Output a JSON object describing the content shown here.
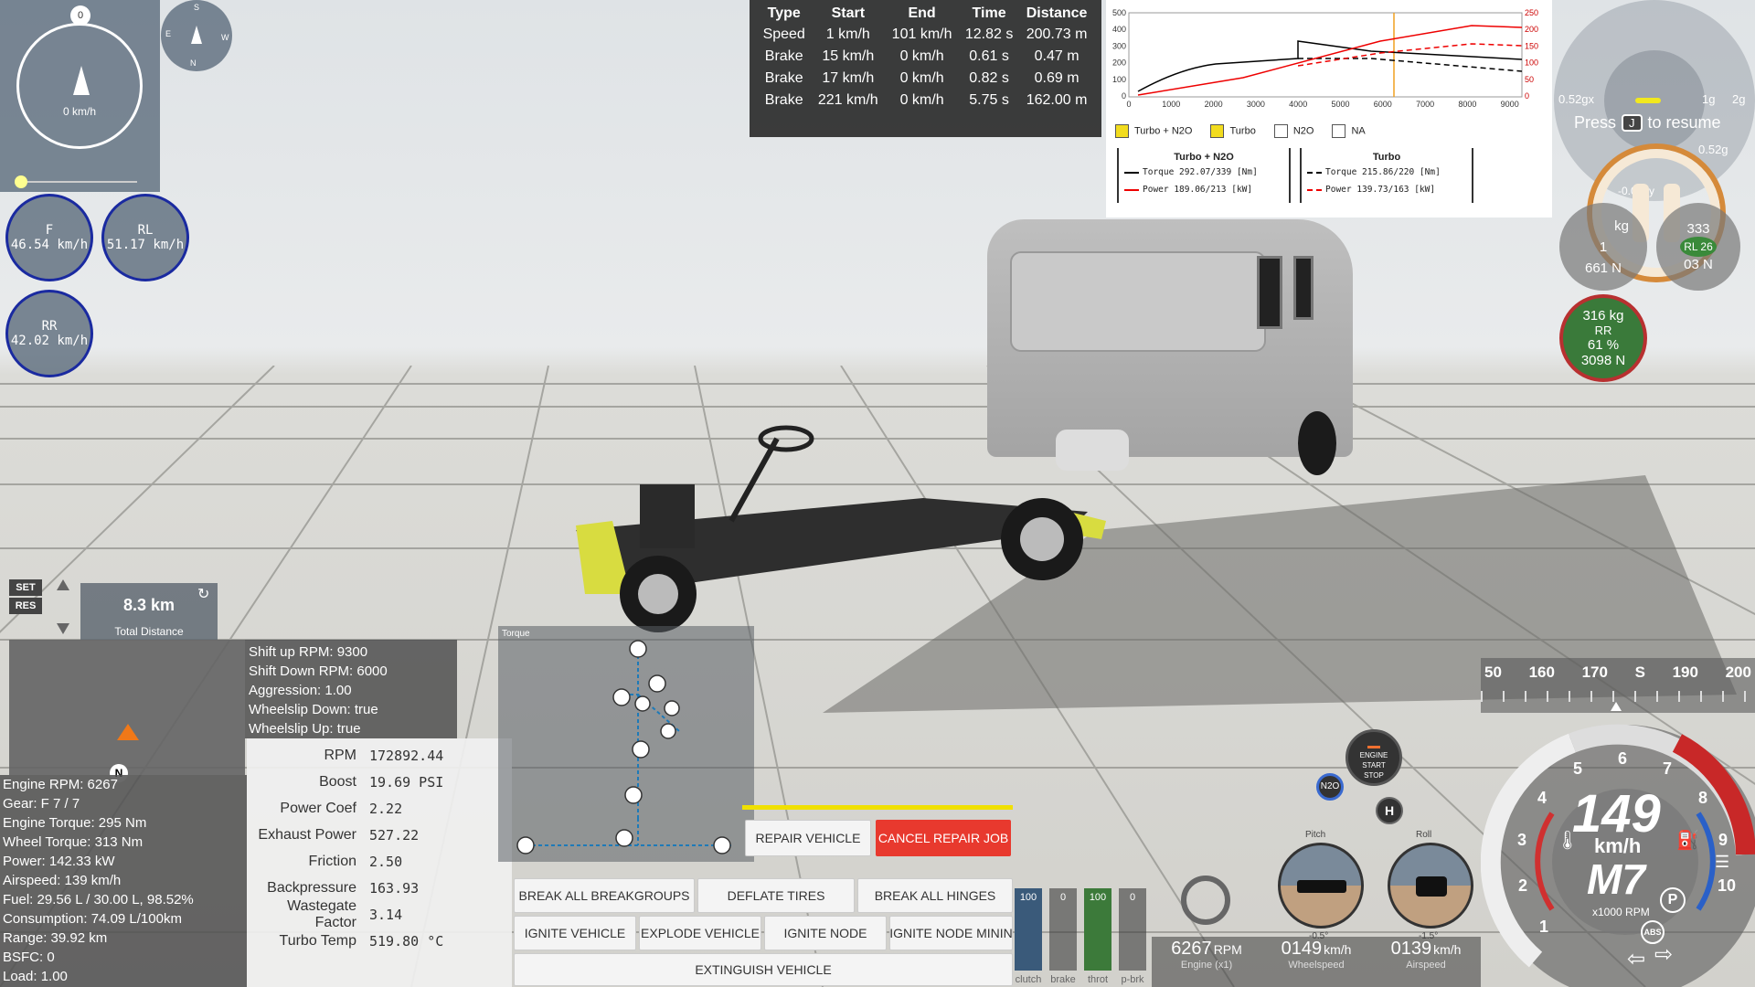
{
  "nav": {
    "north_marker": "0",
    "speed": "0 km/h",
    "compass_small": {
      "s": "S",
      "e": "E",
      "w": "W",
      "n": "N"
    }
  },
  "tire_speeds": [
    {
      "label": "F",
      "value": "46.54 km/h"
    },
    {
      "label": "RL",
      "value": "51.17 km/h"
    },
    {
      "label": "RR",
      "value": "42.02 km/h"
    }
  ],
  "stats_table": {
    "headers": [
      "Type",
      "Start",
      "End",
      "Time",
      "Distance"
    ],
    "rows": [
      [
        "Speed",
        "1 km/h",
        "101 km/h",
        "12.82 s",
        "200.73 m"
      ],
      [
        "Brake",
        "15 km/h",
        "0 km/h",
        "0.61 s",
        "0.47 m"
      ],
      [
        "Brake",
        "17 km/h",
        "0 km/h",
        "0.82 s",
        "0.69 m"
      ],
      [
        "Brake",
        "221 km/h",
        "0 km/h",
        "5.75 s",
        "162.00 m"
      ]
    ]
  },
  "graph": {
    "y_left_ticks": [
      "500",
      "400",
      "300",
      "200",
      "100",
      "0"
    ],
    "y_right_ticks": [
      "250",
      "200",
      "150",
      "100",
      "50",
      "0"
    ],
    "x_ticks": [
      "0",
      "1000",
      "2000",
      "3000",
      "4000",
      "5000",
      "6000",
      "7000",
      "8000",
      "9000"
    ],
    "checkboxes": [
      {
        "label": "Turbo + N2O",
        "checked": true
      },
      {
        "label": "Turbo",
        "checked": true
      },
      {
        "label": "N2O",
        "checked": false
      },
      {
        "label": "NA",
        "checked": false
      }
    ],
    "legend": [
      {
        "title": "Turbo + N2O",
        "torque": "Torque 292.07/339 [Nm]",
        "power": "Power  189.06/213 [kW]"
      },
      {
        "title": "Turbo",
        "torque": "Torque 215.86/220 [Nm]",
        "power": "Power  139.73/163 [kW]"
      }
    ]
  },
  "gforce": {
    "left": "0.52gx",
    "right_top": "1g",
    "right": "2g",
    "bottom": "0.52g",
    "center": "-0.05gy"
  },
  "resume": {
    "press": "Press",
    "key": "J",
    "action": "to resume"
  },
  "wheel_load": {
    "fl": {
      "kg": "kg",
      "n": "661 N",
      "pct": "1"
    },
    "fr": {
      "kg": "333",
      "pct": "RL 26",
      "n": "03 N"
    },
    "rr": {
      "kg": "316 kg",
      "label": "RR",
      "pct": "61 %",
      "n": "3098 N"
    }
  },
  "cruise": {
    "set": "SET",
    "res": "RES",
    "distance": "8.3 km",
    "distance_label": "Total Distance"
  },
  "minimap": {
    "marker": "N"
  },
  "shift_info": [
    "Shift up RPM: 9300",
    "Shift Down RPM: 6000",
    "Aggression: 1.00",
    "Wheelslip Down: true",
    "Wheelslip Up: true"
  ],
  "engine_stats": [
    "Engine RPM: 6267",
    "Gear: F 7 / 7",
    "Engine Torque: 295 Nm",
    "Wheel Torque: 313 Nm",
    "Power: 142.33 kW",
    "Airspeed: 139 km/h",
    "Fuel: 29.56 L / 30.00 L, 98.52%",
    "Consumption: 74.09 L/100km",
    "Range: 39.92 km",
    "BSFC: 0",
    "Load: 1.00"
  ],
  "turbo": [
    {
      "key": "RPM",
      "value": "172892.44"
    },
    {
      "key": "Boost",
      "value": "19.69 PSI"
    },
    {
      "key": "Power Coef",
      "value": "2.22"
    },
    {
      "key": "Exhaust Power",
      "value": "527.22"
    },
    {
      "key": "Friction",
      "value": "2.50"
    },
    {
      "key": "Backpressure",
      "value": "163.93"
    },
    {
      "key": "Wastegate Factor",
      "value": "3.14"
    },
    {
      "key": "Turbo Temp",
      "value": "519.80 °C"
    }
  ],
  "torque_panel": {
    "title": "Torque"
  },
  "buttons": {
    "repair": "REPAIR VEHICLE",
    "cancel_repair": "CANCEL REPAIR JOB",
    "break_breakgroups": "BREAK ALL BREAKGROUPS",
    "deflate": "DEFLATE TIRES",
    "break_hinges": "BREAK ALL HINGES",
    "ignite": "IGNITE VEHICLE",
    "explode": "EXPLODE VEHICLE",
    "ignite_node": "IGNITE NODE",
    "ignite_node_min": "IGNITE NODE MININ",
    "extinguish": "EXTINGUISH VEHICLE"
  },
  "pedals": [
    {
      "name": "clutch",
      "value": "100",
      "color": "#3a5a7a"
    },
    {
      "name": "brake",
      "value": "0",
      "color": "#555555"
    },
    {
      "name": "throt",
      "value": "100",
      "color": "#3c7a3a"
    },
    {
      "name": "p-brk",
      "value": "0",
      "color": "#555555"
    }
  ],
  "bottom_readouts": [
    {
      "value": "6267",
      "unit": "RPM",
      "label": "Engine (x1)"
    },
    {
      "value": "0149",
      "unit": "km/h",
      "label": "Wheelspeed"
    },
    {
      "value": "0139",
      "unit": "km/h",
      "label": "Airspeed"
    }
  ],
  "attitude": {
    "pitch_label": "Pitch",
    "roll_label": "Roll",
    "pitch_value": "-0.5°",
    "roll_value": "-1.5°"
  },
  "engine_button": {
    "line1": "ENGINE",
    "line2": "START",
    "line3": "STOP"
  },
  "nos_label": "N2O",
  "hill_label": "H",
  "heading_strip": [
    "50",
    "160",
    "170",
    "S",
    "190",
    "200"
  ],
  "speedo": {
    "speed": "149",
    "unit": "km/h",
    "gear": "M7",
    "rpm_label": "x1000 RPM",
    "ticks": [
      "1",
      "2",
      "3",
      "4",
      "5",
      "6",
      "7",
      "8",
      "9",
      "10"
    ],
    "park": "P",
    "abs": "ABS"
  }
}
